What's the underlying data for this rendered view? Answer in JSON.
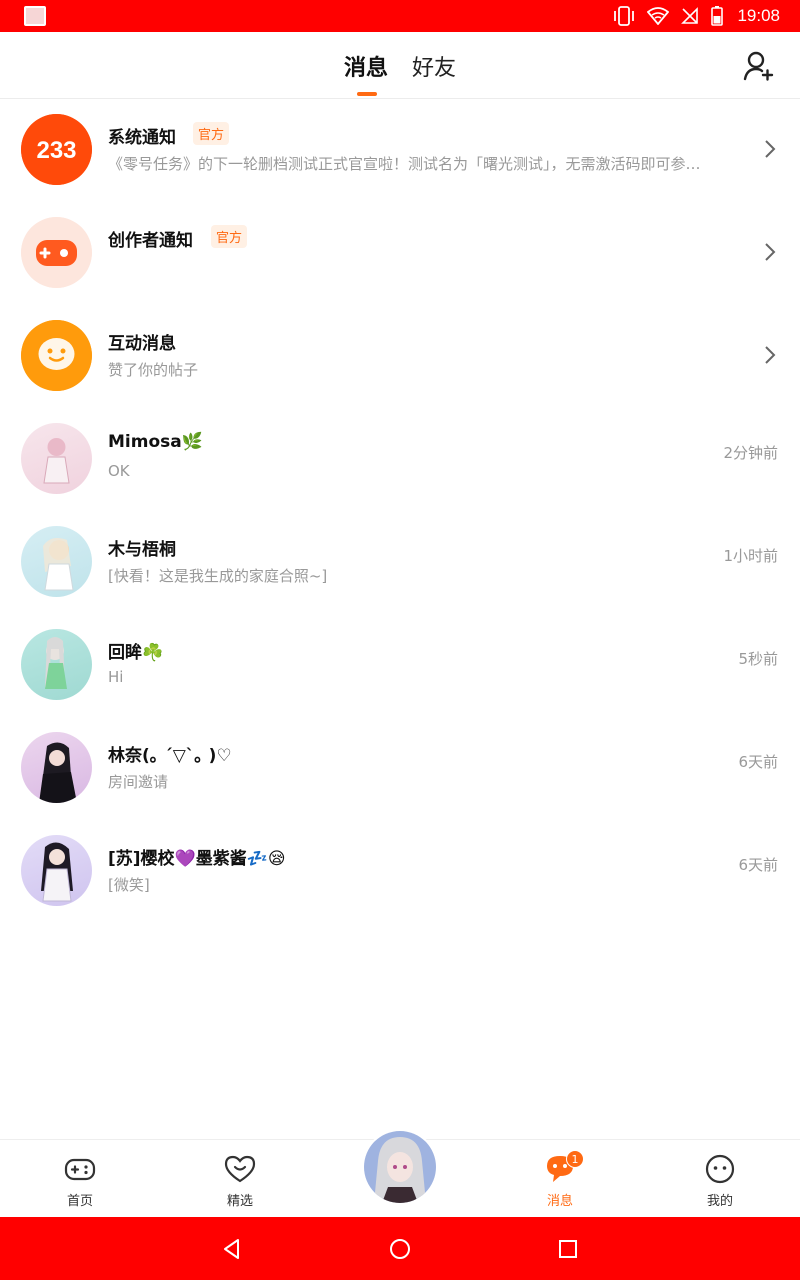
{
  "status_bar": {
    "time": "19:08"
  },
  "header": {
    "tabs": [
      {
        "label": "消息",
        "active": true
      },
      {
        "label": "好友",
        "active": false
      }
    ],
    "add_friend_icon": "add-user-icon"
  },
  "colors": {
    "accent": "#ff6a13",
    "status_bar": "#ff0000",
    "secondary_text": "#999999"
  },
  "notifications": [
    {
      "name": "系统通知",
      "badge": "官方",
      "preview": "《零号任务》的下一轮删档测试正式官宣啦！测试名为「曙光测试」，无需激活码即可参…",
      "avatar_text": "233",
      "icon": "logo-233-icon"
    },
    {
      "name": "创作者通知",
      "badge": "官方",
      "preview": "",
      "icon": "gamepad-icon"
    },
    {
      "name": "互动消息",
      "preview": "赞了你的帖子",
      "icon": "chat-bubble-face-icon"
    }
  ],
  "conversations": [
    {
      "name": "Mimosa🌿",
      "preview": "OK",
      "time": "2分钟前"
    },
    {
      "name": "木与梧桐",
      "preview": "[快看！这是我生成的家庭合照~]",
      "time": "1小时前"
    },
    {
      "name": "回眸☘️",
      "preview": "Hi",
      "time": "5秒前"
    },
    {
      "name": "林奈(｡ ˊ▽ˋ｡ )♡",
      "preview": "房间邀请",
      "time": "6天前"
    },
    {
      "name": "[苏]樱校💜墨紫酱💤😪",
      "preview": "[微笑]",
      "time": "6天前"
    }
  ],
  "bottom_nav": {
    "items": [
      {
        "label": "首页",
        "icon": "gamepad-icon"
      },
      {
        "label": "精选",
        "icon": "heart-icon"
      },
      {
        "label": "消息",
        "icon": "message-icon",
        "active": true,
        "badge": "1"
      },
      {
        "label": "我的",
        "icon": "face-icon"
      }
    ]
  },
  "system_nav": {
    "icons": [
      "back-icon",
      "home-icon",
      "recents-icon"
    ]
  }
}
